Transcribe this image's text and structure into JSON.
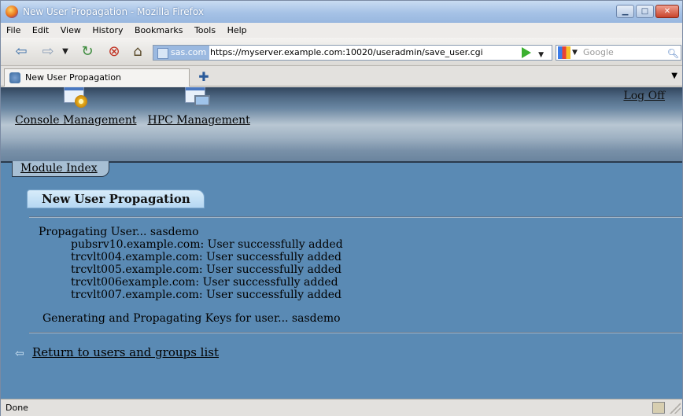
{
  "window": {
    "title": "New User Propagation - Mozilla Firefox"
  },
  "menu": [
    "File",
    "Edit",
    "View",
    "History",
    "Bookmarks",
    "Tools",
    "Help"
  ],
  "nav": {
    "site_badge": "sas.com",
    "url": "https://myserver.example.com:10020/useradmin/save_user.cgi",
    "search_placeholder": "Google"
  },
  "tabs": [
    {
      "label": "New User Propagation"
    }
  ],
  "page": {
    "logoff": "Log Off",
    "apps": [
      {
        "label": "Console Management"
      },
      {
        "label": "HPC Management"
      }
    ],
    "module_index": "Module Index",
    "heading": "New User Propagation",
    "propagating_line": "Propagating User... sasdemo",
    "host_results": [
      "pubsrv10.example.com: User successfully added",
      "trcvlt004.example.com: User successfully added",
      "trcvlt005.example.com: User successfully added",
      "trcvlt006example.com: User successfully added",
      "trcvlt007.example.com: User successfully added"
    ],
    "generating_line": "Generating and Propagating Keys for user... sasdemo",
    "return_link": "Return to users and groups list"
  },
  "status": {
    "text": "Done"
  },
  "colors": {
    "page_bg": "#5a8ab4",
    "heading_tab": "#b5d7f2"
  }
}
